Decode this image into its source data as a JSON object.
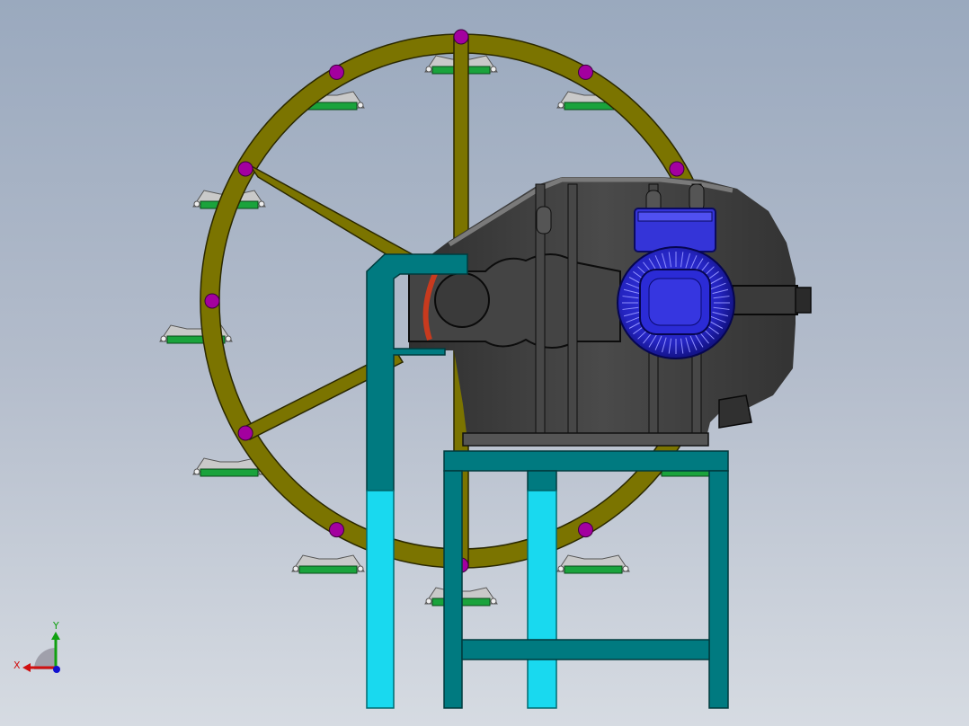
{
  "viewport": {
    "background_top": "#9aa9be",
    "background_bottom": "#d6dbe2"
  },
  "colors": {
    "wheel": "#7b7400",
    "wheel_edge": "#2a2800",
    "bolt": "#a3009f",
    "paddle_bracket": "#c9c9c9",
    "paddle_plate": "#1aa33c",
    "gearbox": "#3c3c3c",
    "gearbox_edge": "#0d0d0d",
    "motor": "#2a2ad0",
    "motor_dark": "#101080",
    "frame": "#007a80",
    "frame_light": "#19d9ef",
    "bearing_ring": "#c83a1e"
  },
  "triad": {
    "x_label": "X",
    "y_label": "Y",
    "x_color": "#d01010",
    "y_color": "#10a010",
    "z_color": "#1010d0"
  },
  "icons": [
    "coordinate-triad-icon"
  ]
}
